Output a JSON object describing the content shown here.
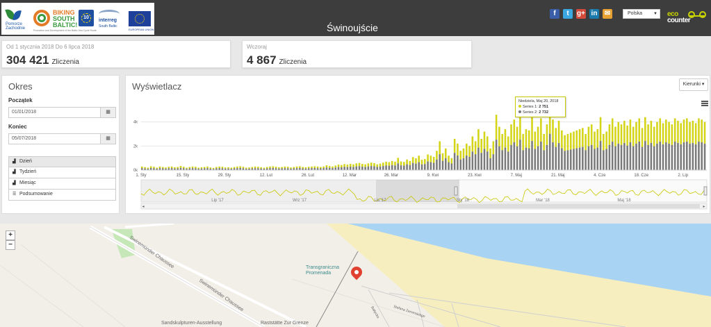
{
  "header": {
    "title": "Świnoujście",
    "logos": {
      "pomorze": "Pomorze Zachodnie",
      "biking_line1": "BIKING",
      "biking_line2": "SOUTH BALTIC!",
      "biking_sub": "Promotion and Development of the Baltic Sea Cycle Route",
      "ten": "10",
      "interreg_line1": "interreg",
      "interreg_line2": "South Baltic",
      "eu": "EUROPEAN UNION"
    },
    "social": [
      {
        "label": "f",
        "icon": "facebook-icon",
        "color": "#3b5ea8"
      },
      {
        "label": "t",
        "icon": "twitter-icon",
        "color": "#3ca8e0"
      },
      {
        "label": "g+",
        "icon": "google-plus-icon",
        "color": "#d44b3a"
      },
      {
        "label": "in",
        "icon": "linkedin-icon",
        "color": "#1a7aab"
      },
      {
        "label": "✉",
        "icon": "mail-icon",
        "color": "#e8a030"
      }
    ],
    "language": "Polska",
    "eco_logo_line1": "eco",
    "eco_logo_line2": "counter"
  },
  "stats": [
    {
      "label": "Od 1 stycznia 2018 Do 6 lipca 2018",
      "value": "304 421",
      "unit": "Zliczenia"
    },
    {
      "label": "Wczoraj",
      "value": "4 867",
      "unit": "Zliczenia"
    }
  ],
  "okres": {
    "title": "Okres",
    "start_label": "Początek",
    "start_value": "01/01/2018",
    "end_label": "Koniec",
    "end_value": "05/07/2018",
    "periods": [
      "Dzień",
      "Tydzień",
      "Miesiąc",
      "Podsumowanie"
    ]
  },
  "chart_panel": {
    "title": "Wyświetlacz",
    "directions_button": "Kierunki ▾",
    "tooltip": {
      "date": "Niedziela, Maj 20, 2018",
      "s1_label": "Series 1:",
      "s1_value": "2 751",
      "s2_label": "Series 2:",
      "s2_value": "2 732"
    },
    "navigator_labels": [
      "Lip '17",
      "Wrz '17",
      "Lis '17",
      "Sty '18",
      "Mar '18",
      "Maj '18"
    ]
  },
  "chart_data": {
    "type": "bar",
    "stacked": true,
    "ytick_labels": [
      "0k",
      "2k",
      "4k"
    ],
    "ylim": [
      0,
      6000
    ],
    "xtick_labels": [
      "1. Sty",
      "15. Sty",
      "29. Sty",
      "12. Lut",
      "26. Lut",
      "12. Mar",
      "26. Mar",
      "9. Kwi",
      "23. Kwi",
      "7. Maj",
      "21. Maj",
      "4. Cze",
      "18. Cze",
      "2. Lip"
    ],
    "series_colors": [
      "#d4d418",
      "#7a7a7a"
    ],
    "series_names": [
      "Series 1",
      "Series 2"
    ],
    "days": 186,
    "total_approx": [
      300,
      250,
      200,
      320,
      280,
      200,
      300,
      260,
      220,
      280,
      300,
      240,
      260,
      340,
      280,
      200,
      260,
      300,
      280,
      200,
      240,
      260,
      300,
      220,
      180,
      260,
      300,
      280,
      220,
      240,
      200,
      260,
      300,
      320,
      280,
      200,
      220,
      260,
      300,
      280,
      240,
      200,
      260,
      300,
      320,
      280,
      240,
      260,
      300,
      280,
      220,
      260,
      300,
      320,
      260,
      240,
      280,
      300,
      320,
      300,
      260,
      300,
      400,
      340,
      300,
      380,
      460,
      420,
      500,
      460,
      520,
      480,
      560,
      600,
      520,
      480,
      560,
      620,
      580,
      480,
      540,
      620,
      700,
      660,
      760,
      700,
      1020,
      720,
      680,
      880,
      760,
      1080,
      980,
      1200,
      860,
      920,
      1300,
      1200,
      1100,
      1600,
      2400,
      1400,
      1800,
      1200,
      1000,
      2600,
      2200,
      1600,
      1800,
      2200,
      2000,
      2800,
      2400,
      3400,
      2600,
      3200,
      2800,
      1800,
      2400,
      4600,
      3600,
      3000,
      3400,
      2800,
      3800,
      4200,
      3600,
      4600,
      3000,
      3400,
      3300,
      4400,
      3200,
      3600,
      4300,
      3000,
      3800,
      5483,
      4200,
      3500,
      4100,
      3300,
      2900,
      3000,
      3100,
      3200,
      3300,
      3400,
      3500,
      3000,
      3600,
      3800,
      3200,
      3400,
      4400,
      3000,
      3200,
      3800,
      4300,
      3600,
      4000,
      3800,
      4100,
      3700,
      4200,
      3600,
      4000,
      4300,
      3500,
      4400,
      3800,
      4100,
      3600,
      4000,
      4300,
      3900,
      4200,
      4000,
      3800,
      4300,
      4100,
      3900,
      4200,
      4300,
      4000,
      4100,
      3900,
      4300,
      4200,
      4000
    ]
  },
  "map": {
    "labels": {
      "street1": "Swinemünder Chaussee",
      "street2": "Swinemünder Chaussee",
      "poi": "Transgraniczna Promenada",
      "bottom1": "Sandskulpturen-Ausstellung",
      "bottom2": "Raststätte Zur Grenze",
      "small1": "Bałtycka",
      "small2": "Stefana Żeromskiego"
    },
    "zoom_in": "+",
    "zoom_out": "−",
    "colors": {
      "sea": "#a9d3f2",
      "beach": "#f7eec0",
      "park": "#c6e8b8"
    }
  }
}
